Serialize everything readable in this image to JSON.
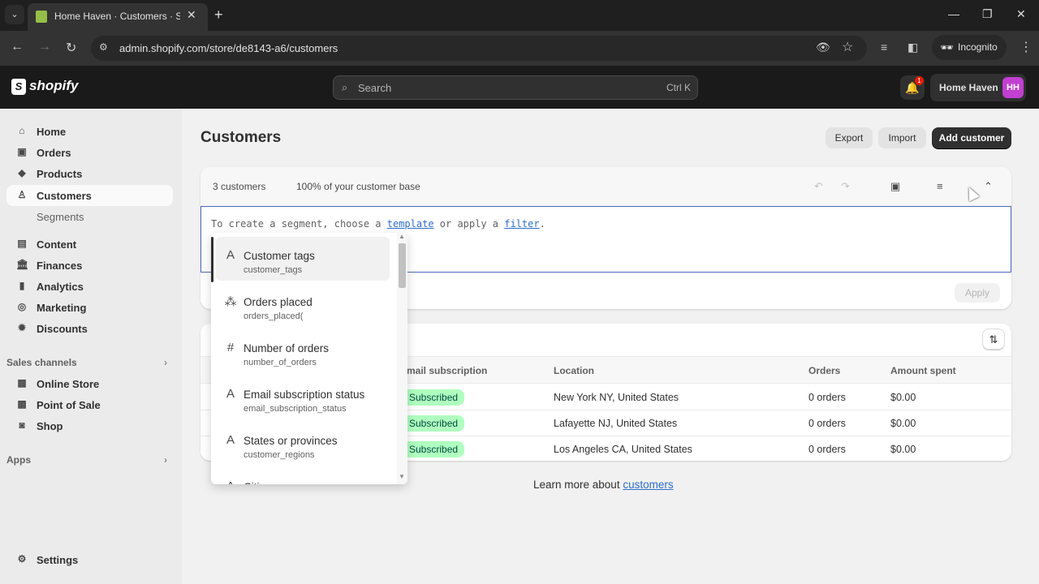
{
  "browser": {
    "tab_title": "Home Haven · Customers · Shopify",
    "url": "admin.shopify.com/store/de8143-a6/customers",
    "profile_label": "Incognito"
  },
  "topbar": {
    "logo_text": "shopify",
    "search_placeholder": "Search",
    "search_shortcut": "Ctrl K",
    "notification_count": "1",
    "store_name": "Home Haven",
    "avatar_initials": "HH"
  },
  "sidebar": {
    "items": [
      {
        "label": "Home",
        "icon": "home-icon"
      },
      {
        "label": "Orders",
        "icon": "orders-icon"
      },
      {
        "label": "Products",
        "icon": "tag-icon"
      },
      {
        "label": "Customers",
        "icon": "person-icon",
        "active": true
      },
      {
        "label": "Segments",
        "sub": true
      },
      {
        "label": "Content",
        "icon": "content-icon"
      },
      {
        "label": "Finances",
        "icon": "bank-icon"
      },
      {
        "label": "Analytics",
        "icon": "bar-chart-icon"
      },
      {
        "label": "Marketing",
        "icon": "target-icon"
      },
      {
        "label": "Discounts",
        "icon": "discount-icon"
      }
    ],
    "sales_channels_label": "Sales channels",
    "channels": [
      {
        "label": "Online Store",
        "icon": "store-icon"
      },
      {
        "label": "Point of Sale",
        "icon": "pos-icon"
      },
      {
        "label": "Shop",
        "icon": "shop-icon"
      }
    ],
    "apps_label": "Apps",
    "settings_label": "Settings"
  },
  "page": {
    "title": "Customers",
    "export_label": "Export",
    "import_label": "Import",
    "add_customer_label": "Add customer"
  },
  "segment": {
    "count_text": "3 customers",
    "percent_text": "100% of your customer base",
    "hint_prefix": "To create a segment, choose a ",
    "template_link": "template",
    "hint_middle": " or apply a ",
    "filter_link": "filter",
    "hint_suffix": ".",
    "apply_label": "Apply"
  },
  "dropdown": {
    "items": [
      {
        "label": "Customer tags",
        "field": "customer_tags",
        "icon": "A"
      },
      {
        "label": "Orders placed",
        "field": "orders_placed(",
        "icon": "⁂"
      },
      {
        "label": "Number of orders",
        "field": "number_of_orders",
        "icon": "#"
      },
      {
        "label": "Email subscription status",
        "field": "email_subscription_status",
        "icon": "A"
      },
      {
        "label": "States or provinces",
        "field": "customer_regions",
        "icon": "A"
      },
      {
        "label": "Cities",
        "field": "",
        "icon": "A"
      }
    ]
  },
  "table": {
    "columns": [
      "mail subscription",
      "Location",
      "Orders",
      "Amount spent"
    ],
    "rows": [
      {
        "subscription": "Subscribed",
        "location": "New York NY, United States",
        "orders": "0 orders",
        "amount": "$0.00"
      },
      {
        "subscription": "Subscribed",
        "location": "Lafayette NJ, United States",
        "orders": "0 orders",
        "amount": "$0.00"
      },
      {
        "subscription": "Subscribed",
        "location": "Los Angeles CA, United States",
        "orders": "0 orders",
        "amount": "$0.00"
      }
    ]
  },
  "footer": {
    "learn_prefix": "Learn more about ",
    "learn_link": "customers"
  }
}
